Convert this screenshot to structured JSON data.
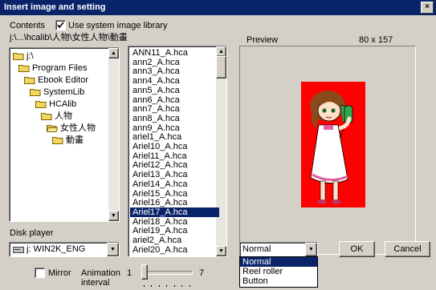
{
  "window": {
    "title": "Insert image and setting",
    "close_glyph": "×"
  },
  "contents": {
    "label": "Contents",
    "checkbox_label": "Use system image library",
    "checked": true,
    "path": "j:\\...\\hcalib\\人物\\女性人物\\動畫"
  },
  "tree": [
    {
      "label": "j:\\",
      "indent": 0
    },
    {
      "label": "Program Files",
      "indent": 1
    },
    {
      "label": "Ebook Editor",
      "indent": 2
    },
    {
      "label": "SystemLib",
      "indent": 3
    },
    {
      "label": "HCAlib",
      "indent": 4
    },
    {
      "label": "人物",
      "indent": 5
    },
    {
      "label": "女性人物",
      "indent": 6,
      "open": true
    },
    {
      "label": "動畫",
      "indent": 7
    }
  ],
  "files": [
    "ANN11_A.hca",
    "ann2_A.hca",
    "ann3_A.hca",
    "ann4_A.hca",
    "ann5_A.hca",
    "ann6_A.hca",
    "ann7_A.hca",
    "ann8_A.hca",
    "ann9_A.hca",
    "ariel1_A.hca",
    "Ariel10_A.hca",
    "Ariel11_A.hca",
    "Ariel12_A.hca",
    "Ariel13_A.hca",
    "Ariel14_A.hca",
    "Ariel15_A.hca",
    "Ariel16_A.hca",
    "Ariel17_A.hca",
    "Ariel18_A.hca",
    "Ariel19_A.hca",
    "ariel2_A.hca",
    "Ariel20_A.hca"
  ],
  "selected_file": "Ariel17_A.hca",
  "disk": {
    "label": "Disk player",
    "value": "j: WIN2K_ENG"
  },
  "mirror": {
    "label": "Mirror",
    "checked": false
  },
  "animation": {
    "label_line1": "Animation",
    "label_line2": "interval",
    "min": "1",
    "max": "7"
  },
  "preview": {
    "label": "Preview",
    "size": "80 x 157",
    "bg_color": "#ff0000"
  },
  "mode": {
    "value": "Normal",
    "options": [
      "Normal",
      "Reel roller",
      "Button"
    ],
    "selected": "Normal"
  },
  "buttons": {
    "ok": "OK",
    "cancel": "Cancel"
  },
  "colors": {
    "title_bg": "#0a246a",
    "selection": "#0a246a",
    "face": "#d4d0c8"
  }
}
